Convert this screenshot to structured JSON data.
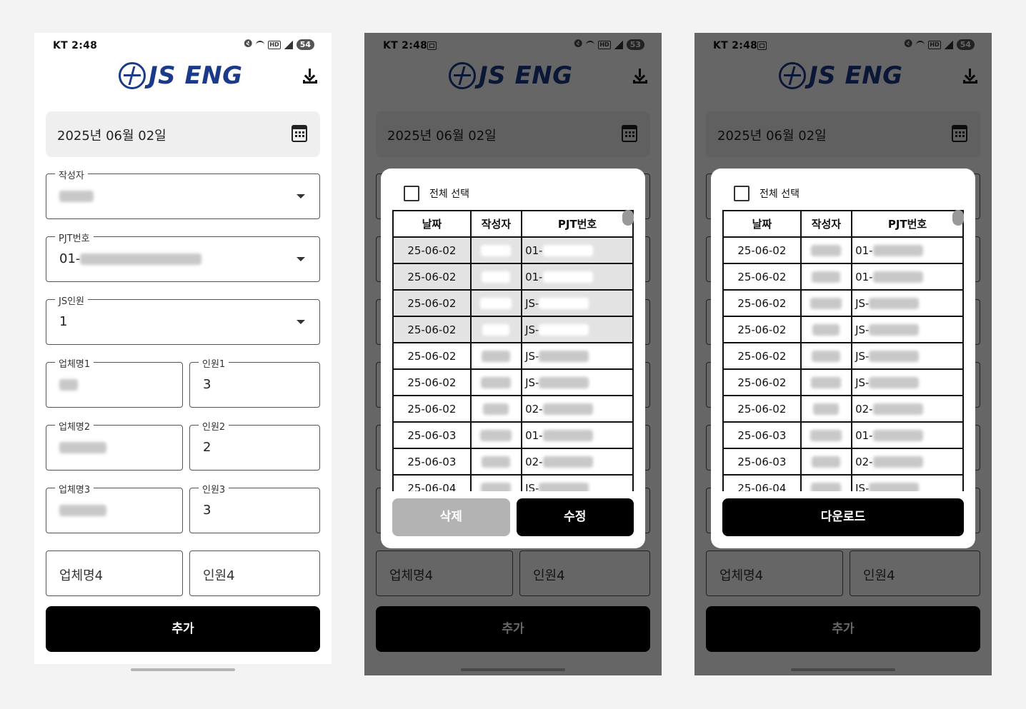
{
  "status": {
    "carrier_time": "KT 2:48",
    "battery": [
      "54",
      "53",
      "54"
    ]
  },
  "app": {
    "logo_text": "JS ENG"
  },
  "form": {
    "date": "2025년 06월 02일",
    "writer_label": "작성자",
    "pjt_label": "PJT번호",
    "pjt_prefix": "01-",
    "js_staff_label": "JS인원",
    "js_staff_value": "1",
    "company1_label": "업체명1",
    "staff1_label": "인원1",
    "staff1_value": "3",
    "company2_label": "업체명2",
    "staff2_label": "인원2",
    "staff2_value": "2",
    "company3_label": "업체명3",
    "staff3_label": "인원3",
    "staff3_value": "3",
    "company4_placeholder": "업체명4",
    "staff4_placeholder": "인원4",
    "add_button": "추가"
  },
  "modal": {
    "select_all": "전체 선택",
    "columns": [
      "날짜",
      "작성자",
      "PJT번호"
    ],
    "rows": [
      {
        "date": "25-06-02",
        "pjt": "01-"
      },
      {
        "date": "25-06-02",
        "pjt": "01-"
      },
      {
        "date": "25-06-02",
        "pjt": "JS-"
      },
      {
        "date": "25-06-02",
        "pjt": "JS-"
      },
      {
        "date": "25-06-02",
        "pjt": "JS-"
      },
      {
        "date": "25-06-02",
        "pjt": "JS-"
      },
      {
        "date": "25-06-02",
        "pjt": "02-"
      },
      {
        "date": "25-06-03",
        "pjt": "01-"
      },
      {
        "date": "25-06-03",
        "pjt": "02-"
      },
      {
        "date": "25-06-04",
        "pjt": "JS-"
      }
    ],
    "delete_button": "삭제",
    "edit_button": "수정",
    "download_button": "다운로드"
  }
}
